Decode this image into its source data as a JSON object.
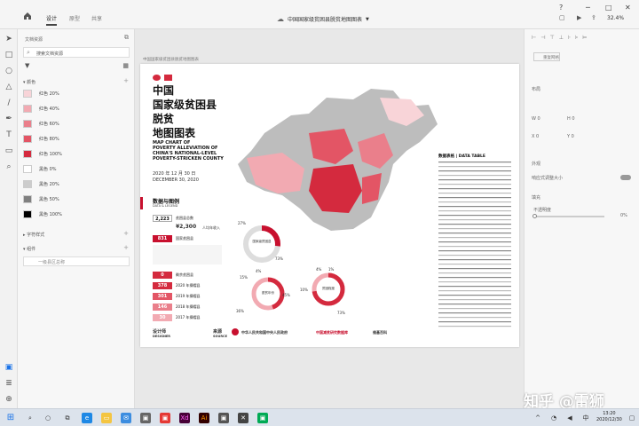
{
  "window": {
    "title": "中国国家级贫困县脱贫地图图表",
    "zoom": "32.4%"
  },
  "tabs": [
    {
      "label": "设计"
    },
    {
      "label": "原型"
    },
    {
      "label": "共享"
    }
  ],
  "left_panel": {
    "header": "文档资源",
    "search_placeholder": "搜索文档资源",
    "colors_section": "颜色",
    "colors": [
      {
        "label": "红色 20%",
        "hex": "#f8d4d8"
      },
      {
        "label": "红色 40%",
        "hex": "#f2aab2"
      },
      {
        "label": "红色 60%",
        "hex": "#ea7f8b"
      },
      {
        "label": "红色 80%",
        "hex": "#e35565"
      },
      {
        "label": "红色 100%",
        "hex": "#d42a3e"
      },
      {
        "label": "黑色 0%",
        "hex": "#ffffff"
      },
      {
        "label": "黑色 20%",
        "hex": "#cccccc"
      },
      {
        "label": "黑色 50%",
        "hex": "#808080"
      },
      {
        "label": "黑色 100%",
        "hex": "#000000"
      }
    ],
    "char_styles_section": "字符样式",
    "components_section": "组件",
    "components_placeholder": "一级县区总称"
  },
  "artboard": {
    "label": "中国国家级贫困县脱贫地图图表",
    "title_cn": [
      "中国",
      "国家级贫困县",
      "脱贫",
      "地图图表"
    ],
    "title_en": [
      "MAP CHART OF",
      "POVERTY ALLEVIATION OF",
      "CHINA'S NATIONAL-LEVEL",
      "POVERTY-STRICKEN COUNTY"
    ],
    "date_cn": "2020 年 12 月 30 日",
    "date_en": "DECEMBER 30, 2020",
    "legend_title": "数据与图例",
    "legend_sub": "DATA & LEGEND",
    "stats": [
      {
        "value": "2,223",
        "label": "贫困县总数"
      },
      {
        "value": "¥2,300",
        "label": "人均年收入"
      },
      {
        "value": "831",
        "label": "国家贫困县"
      }
    ],
    "year_boxes": [
      {
        "value": "0",
        "label": "剩余贫困县"
      },
      {
        "value": "378",
        "label": "2020 年摘帽县"
      },
      {
        "value": "301",
        "label": "2019 年摘帽县"
      },
      {
        "value": "146",
        "label": "2018 年摘帽县"
      },
      {
        "value": "30",
        "label": "2017 年摘帽县"
      }
    ],
    "donuts": [
      {
        "pct_a": "27%",
        "pct_b": "73%",
        "center": "国家级贫困县"
      },
      {
        "pct_a": "4%",
        "pct_b": "45%",
        "pct_c": "15%",
        "pct_d": "36%",
        "center": "脱贫年份"
      },
      {
        "pct_a": "4%",
        "pct_b": "1%",
        "pct_c": "10%",
        "pct_d": "73%",
        "center": "贫困程度"
      }
    ],
    "table_title": "数据表格 | DATA TABLE",
    "footer": {
      "designer": "设计师",
      "designer_en": "DESIGNER",
      "source": "来源",
      "source_en": "SOURCE",
      "org1": "中华人民共和国中央人民政府",
      "org2": "中国减贫研究数据库",
      "org3": "维基百科"
    }
  },
  "right_panel": {
    "align": "重复网格",
    "layout": "布局",
    "appearance": "外观",
    "responsive": "响应式调整大小",
    "opacity_label": "不透明度",
    "opacity": "0%",
    "blend": "填充"
  },
  "taskbar": {
    "time": "13:20",
    "date": "2020/12/30"
  },
  "watermark": "知乎 @雷狮"
}
